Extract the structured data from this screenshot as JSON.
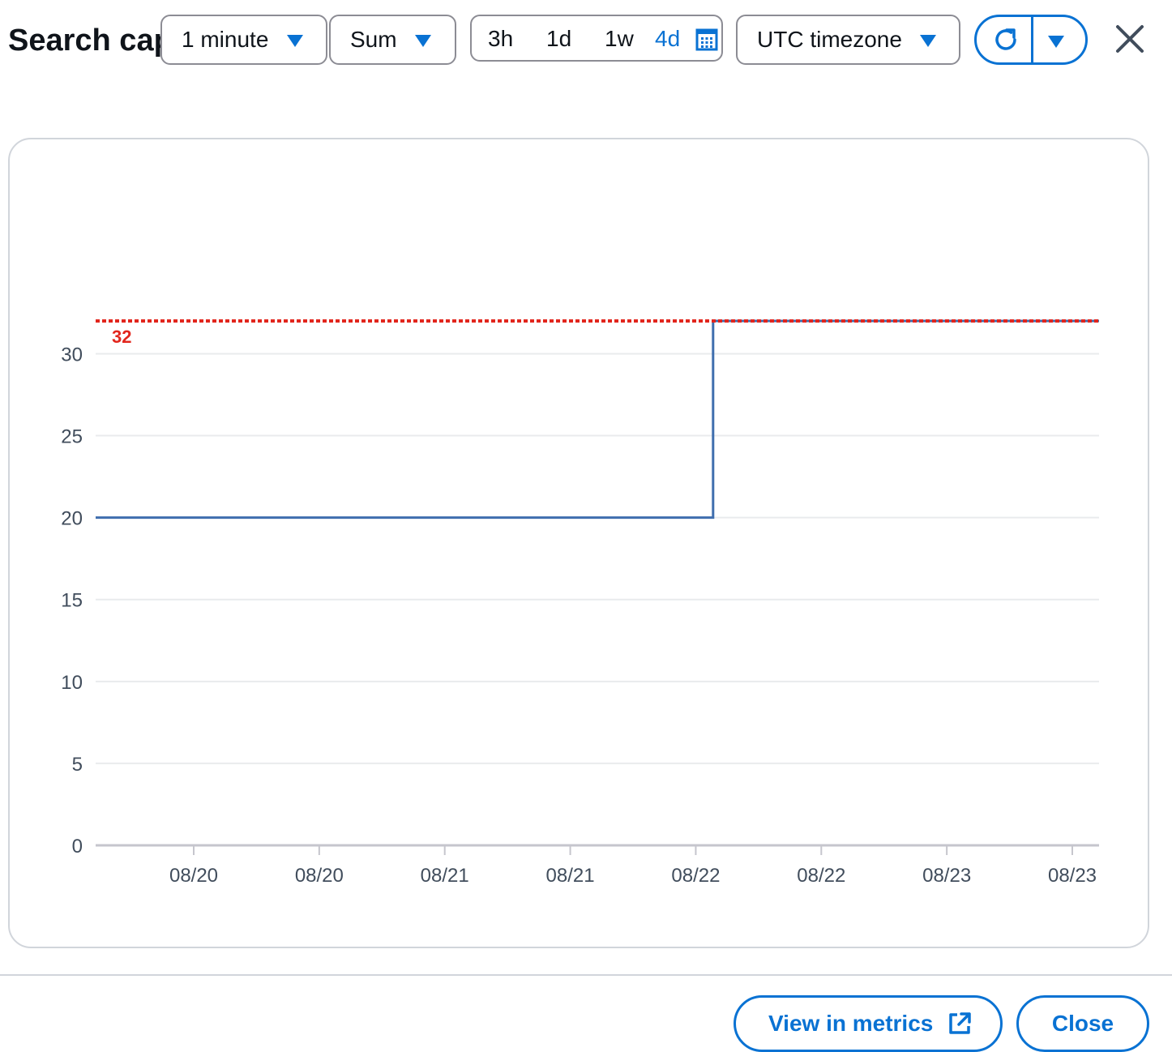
{
  "header": {
    "title": "Search capacity",
    "period": {
      "value": "1 minute",
      "icon": "caret-down-icon"
    },
    "statistic": {
      "value": "Sum",
      "icon": "caret-down-icon"
    },
    "time_range": {
      "options": [
        "3h",
        "1d",
        "1w",
        "4d"
      ],
      "selected": "4d",
      "calendar_icon": "calendar-icon"
    },
    "timezone": {
      "value": "UTC timezone",
      "icon": "caret-down-icon"
    },
    "refresh": {
      "icon": "refresh-icon",
      "menu_icon": "caret-down-icon"
    },
    "close_icon": "close-icon"
  },
  "chart_data": {
    "type": "line",
    "title": "",
    "xlabel": "",
    "ylabel": "",
    "x_tick_labels": [
      "08/20",
      "08/20",
      "08/21",
      "08/21",
      "08/22",
      "08/22",
      "08/23",
      "08/23"
    ],
    "y_ticks": [
      0,
      5,
      10,
      15,
      20,
      25,
      30
    ],
    "ylim": [
      0,
      32
    ],
    "grid": true,
    "legend": "none",
    "series": [
      {
        "color": "#3f6eae",
        "step": true,
        "points": [
          {
            "x": "08/19 17:00",
            "y": 20
          },
          {
            "x": "08/22 01:00",
            "y": 20
          },
          {
            "x": "08/22 01:00",
            "y": 32
          },
          {
            "x": "08/23 12:00",
            "y": 32
          }
        ]
      }
    ],
    "threshold": {
      "value": 32,
      "label": "32",
      "color": "#e2261d",
      "style": "dotted"
    }
  },
  "footer": {
    "view_in_metrics_label": "View in metrics",
    "view_in_metrics_icon": "external-link-icon",
    "close_label": "Close"
  },
  "colors": {
    "accent": "#0972d3",
    "series": "#3f6eae",
    "threshold": "#e2261d",
    "border": "#8c8c94"
  }
}
